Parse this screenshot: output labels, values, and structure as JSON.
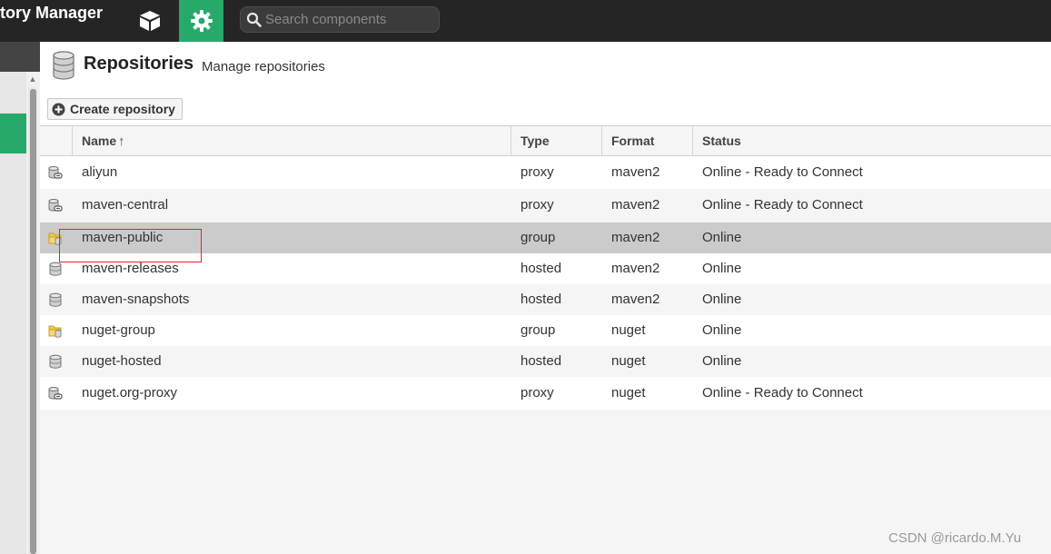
{
  "header": {
    "app_title": "tory Manager",
    "browse_icon": "cube-icon",
    "admin_icon": "gear-icon",
    "search": {
      "placeholder": "Search components",
      "value": ""
    },
    "colors": {
      "bar": "#252525",
      "accent": "#26a96b"
    }
  },
  "page": {
    "title": "Repositories",
    "subtitle": "Manage repositories",
    "create_button": "Create repository"
  },
  "grid": {
    "columns": [
      {
        "label": "Name",
        "sort": "asc"
      },
      {
        "label": "Type"
      },
      {
        "label": "Format"
      },
      {
        "label": "Status"
      }
    ],
    "rows": [
      {
        "icon": "proxy-repository-icon",
        "name": "aliyun",
        "type": "proxy",
        "format": "maven2",
        "status": "Online - Ready to Connect"
      },
      {
        "icon": "proxy-repository-icon",
        "name": "maven-central",
        "type": "proxy",
        "format": "maven2",
        "status": "Online - Ready to Connect"
      },
      {
        "icon": "group-repository-icon",
        "name": "maven-public",
        "type": "group",
        "format": "maven2",
        "status": "Online",
        "selected": true
      },
      {
        "icon": "hosted-repository-icon",
        "name": "maven-releases",
        "type": "hosted",
        "format": "maven2",
        "status": "Online"
      },
      {
        "icon": "hosted-repository-icon",
        "name": "maven-snapshots",
        "type": "hosted",
        "format": "maven2",
        "status": "Online"
      },
      {
        "icon": "group-repository-icon",
        "name": "nuget-group",
        "type": "group",
        "format": "nuget",
        "status": "Online"
      },
      {
        "icon": "hosted-repository-icon",
        "name": "nuget-hosted",
        "type": "hosted",
        "format": "nuget",
        "status": "Online"
      },
      {
        "icon": "proxy-repository-icon",
        "name": "nuget.org-proxy",
        "type": "proxy",
        "format": "nuget",
        "status": "Online - Ready to Connect"
      }
    ]
  },
  "watermark": "CSDN @ricardo.M.Yu"
}
